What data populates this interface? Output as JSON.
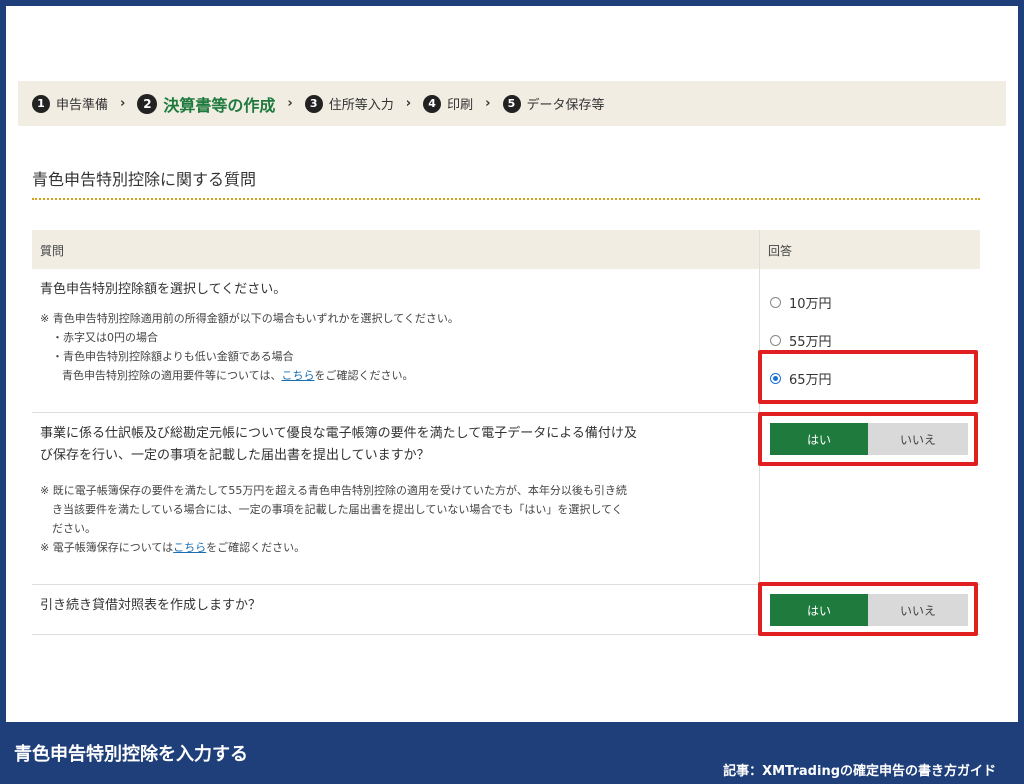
{
  "steps": [
    {
      "num": "1",
      "label": "申告準備"
    },
    {
      "num": "2",
      "label": "決算書等の作成"
    },
    {
      "num": "3",
      "label": "住所等入力"
    },
    {
      "num": "4",
      "label": "印刷"
    },
    {
      "num": "5",
      "label": "データ保存等"
    }
  ],
  "step_separator": "›",
  "section_title": "青色申告特別控除に関する質問",
  "table": {
    "col_question": "質問",
    "col_answer": "回答"
  },
  "q1": {
    "text": "青色申告特別控除額を選択してください。",
    "note_line1": "※ 青色申告特別控除適用前の所得金額が以下の場合もいずれかを選択してください。",
    "note_line2": "・赤字又は0円の場合",
    "note_line3": "・青色申告特別控除額よりも低い金額である場合",
    "note_line4_pre": "青色申告特別控除の適用要件等については、",
    "note_line4_link": "こちら",
    "note_line4_post": "をご確認ください。",
    "options": [
      {
        "label": "10万円",
        "checked": false
      },
      {
        "label": "55万円",
        "checked": false
      },
      {
        "label": "65万円",
        "checked": true
      }
    ]
  },
  "q2": {
    "text_line1": "事業に係る仕訳帳及び総勘定元帳について優良な電子帳簿の要件を満たして電子データによる備付け及",
    "text_line2": "び保存を行い、一定の事項を記載した届出書を提出していますか？",
    "note_line1": "※ 既に電子帳簿保存の要件を満たして55万円を超える青色申告特別控除の適用を受けていた方が、本年分以後も引き続",
    "note_line2": "き当該要件を満たしている場合には、一定の事項を記載した届出書を提出していない場合でも「はい」を選択してく",
    "note_line3": "ださい。",
    "note_line4_pre": "※ 電子帳簿保存については",
    "note_line4_link": "こちら",
    "note_line4_post": "をご確認ください。",
    "yes_label": "はい",
    "no_label": "いいえ",
    "selected": "yes"
  },
  "q3": {
    "text": "引き続き貸借対照表を作成しますか？",
    "yes_label": "はい",
    "no_label": "いいえ",
    "selected": "yes"
  },
  "footer": {
    "title": "青色申告特別控除を入力する",
    "article": "記事：XMTradingの確定申告の書き方ガイド"
  },
  "colors": {
    "brand_blue": "#1f3f7a",
    "accent_green": "#1f7a3e",
    "highlight_red": "#e02020",
    "header_beige": "#f1ede3"
  }
}
